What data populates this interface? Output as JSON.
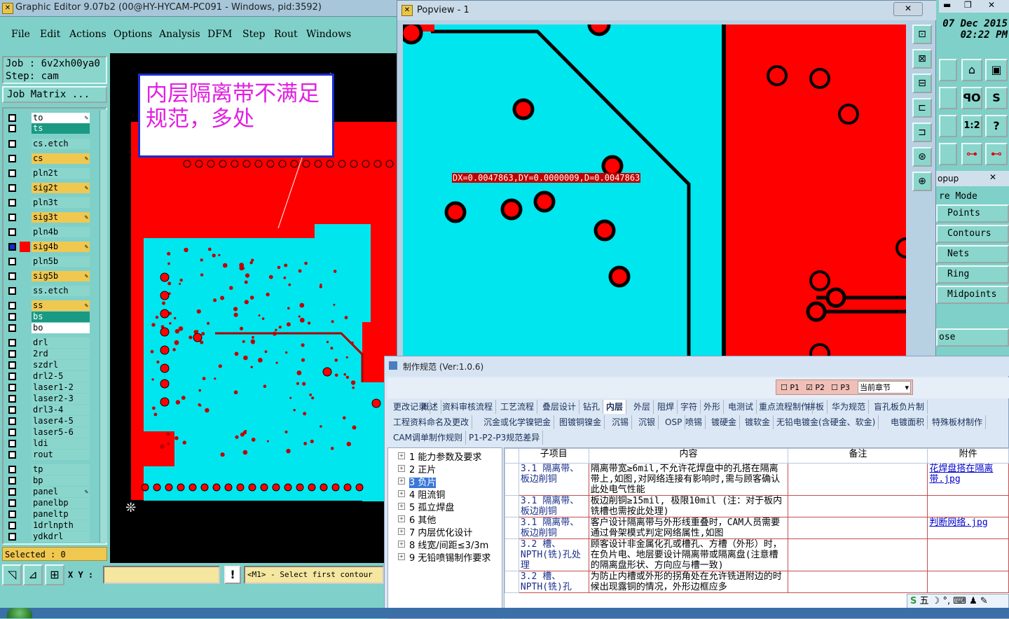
{
  "main_window": {
    "title": "Graphic Editor 9.07b2 (00@HY-HYCAM-PC091 - Windows, pid:3592)",
    "menu": [
      "File",
      "Edit",
      "Actions",
      "Options",
      "Analysis",
      "DFM",
      "Step",
      "Rout",
      "Windows"
    ]
  },
  "job_panel": {
    "job": "Job  :  6v2xh00ya0",
    "step": "Step: cam",
    "matrix_button": "Job Matrix ..."
  },
  "layers": [
    {
      "name": "to",
      "bg": "#ffffff",
      "edit": true
    },
    {
      "name": "ts",
      "bg": "#1a9a82",
      "edit": false
    },
    {
      "name": "cs.etch",
      "bg": "#8ad6cd",
      "edit": false
    },
    {
      "name": "cs",
      "bg": "#f0c850",
      "edit": true
    },
    {
      "name": "pln2t",
      "bg": "#8ad6cd",
      "edit": false
    },
    {
      "name": "sig2t",
      "bg": "#f0c850",
      "edit": true
    },
    {
      "name": "pln3t",
      "bg": "#8ad6cd",
      "edit": false
    },
    {
      "name": "sig3t",
      "bg": "#f0c850",
      "edit": true
    },
    {
      "name": "pln4b",
      "bg": "#8ad6cd",
      "edit": false
    },
    {
      "name": "sig4b",
      "bg": "#f0c850",
      "edit": true
    },
    {
      "name": "pln5b",
      "bg": "#8ad6cd",
      "edit": false
    },
    {
      "name": "sig5b",
      "bg": "#f0c850",
      "edit": true
    },
    {
      "name": "ss.etch",
      "bg": "#8ad6cd",
      "edit": false
    },
    {
      "name": "ss",
      "bg": "#f0c850",
      "edit": true
    },
    {
      "name": "bs",
      "bg": "#1a9a82",
      "edit": false
    },
    {
      "name": "bo",
      "bg": "#ffffff",
      "edit": false
    },
    {
      "name": "drl",
      "bg": "#8ad6cd",
      "edit": false
    },
    {
      "name": "2rd",
      "bg": "#8ad6cd",
      "edit": false
    },
    {
      "name": "szdrl",
      "bg": "#8ad6cd",
      "edit": false
    },
    {
      "name": "drl2-5",
      "bg": "#8ad6cd",
      "edit": false
    },
    {
      "name": "laser1-2",
      "bg": "#8ad6cd",
      "edit": false
    },
    {
      "name": "laser2-3",
      "bg": "#8ad6cd",
      "edit": false
    },
    {
      "name": "drl3-4",
      "bg": "#8ad6cd",
      "edit": false
    },
    {
      "name": "laser4-5",
      "bg": "#8ad6cd",
      "edit": false
    },
    {
      "name": "laser5-6",
      "bg": "#8ad6cd",
      "edit": false
    },
    {
      "name": "ldi",
      "bg": "#8ad6cd",
      "edit": false
    },
    {
      "name": "rout",
      "bg": "#8ad6cd",
      "edit": false
    },
    {
      "name": "tp",
      "bg": "#8ad6cd",
      "edit": false
    },
    {
      "name": "bp",
      "bg": "#8ad6cd",
      "edit": false
    },
    {
      "name": "panel",
      "bg": "#8ad6cd",
      "edit": true
    },
    {
      "name": "panelbp",
      "bg": "#8ad6cd",
      "edit": false
    },
    {
      "name": "paneltp",
      "bg": "#8ad6cd",
      "edit": false
    },
    {
      "name": "1drlnpth",
      "bg": "#8ad6cd",
      "edit": false
    },
    {
      "name": "ydkdrl",
      "bg": "#8ad6cd",
      "edit": false
    }
  ],
  "selected": "Selected : 0",
  "annotation": "内层隔离带不满足规范，多处",
  "status_bar": {
    "xy_label": "X Y :",
    "xy_value": "",
    "prompt": "<M1> - Select first contour"
  },
  "popview": {
    "title": "Popview - 1",
    "measure": "DX=0.0047863,DY=0.0000009,D=0.0047863"
  },
  "right_panel": {
    "date": "07 Dec 2015",
    "time": "02:22 PM",
    "popup_title": "opup",
    "mode_title": "re Mode",
    "modes": [
      "Points",
      "Contours",
      "Nets",
      "Ring",
      "Midpoints"
    ],
    "close": "ose",
    "ratio": "1:2",
    "help": "?"
  },
  "spec_window": {
    "title": "制作规范 (Ver:1.0.6)",
    "toolbar": {
      "p1": "P1",
      "p2": "P2",
      "p3": "P3",
      "chapter": "当前章节"
    },
    "tabs_row1": [
      "更改记录",
      "概述",
      "资料审核流程",
      "工艺流程",
      "叠层设计",
      "钻孔",
      "内层",
      "外层",
      "阻焊",
      "字符",
      "外形",
      "电测试",
      "重点流程制作",
      "拼板",
      "华为规范",
      "盲孔板负片制"
    ],
    "tabs_row2": [
      "工程资料命名及更改",
      "沉金或化学镍钯金",
      "图镀铜镍金",
      "沉锡",
      "沉银",
      "OSP",
      "喷锡",
      "镀硬金",
      "镀软金",
      "无铅电镀金(含硬金、软金)",
      "电镀面积",
      "特殊板材制作"
    ],
    "tabs_row3": [
      "CAM调单制作规则",
      "P1-P2-P3规范差异"
    ],
    "tree": [
      "1 能力参数及要求",
      "2 正片",
      "3 负片",
      "4 阻流铜",
      "5 孤立焊盘",
      "6 其他",
      "7 内层优化设计",
      "8 线宽/间距≤3/3m",
      "9 无铅喷锡制作要求"
    ],
    "columns": [
      "子项目",
      "内容",
      "备注",
      "附件"
    ],
    "rows": [
      {
        "item": "3.1 隔离带、板边削铜",
        "content": "隔离带宽≥6mil,不允许花焊盘中的孔搭在隔离带上,如图,对网络连接有影响时,需与顾客确认此处电气性能",
        "note": "",
        "attach": "花焊盘搭在隔离带.jpg"
      },
      {
        "item": "3.1 隔离带、板边削铜",
        "content": "板边削铜≥15mil, 极限10mil (注：对于板内铣槽也需按此处理)",
        "note": "",
        "attach": ""
      },
      {
        "item": "3.1 隔离带、板边削铜",
        "content": "客户设计隔离带与外形线重叠时，CAM人员需要通过骨架模式判定网络属性,如图",
        "note": "",
        "attach": "判断网络.jpg"
      },
      {
        "item": "3.2 槽、NPTH(铣)孔处理",
        "content": "顾客设计非金属化孔或槽孔、方槽（外形）时，在负片电、地层要设计隔离带或隔离盘(注意槽的隔离盘形状、方向应与槽一致)",
        "note": "",
        "attach": ""
      },
      {
        "item": "3.2 槽、NPTH(铣)孔",
        "content": "为防止内槽或外形的拐角处在允许铣进附边的时候出现露铜的情况，外形边框应多",
        "note": "",
        "attach": ""
      }
    ]
  },
  "ime": "五"
}
